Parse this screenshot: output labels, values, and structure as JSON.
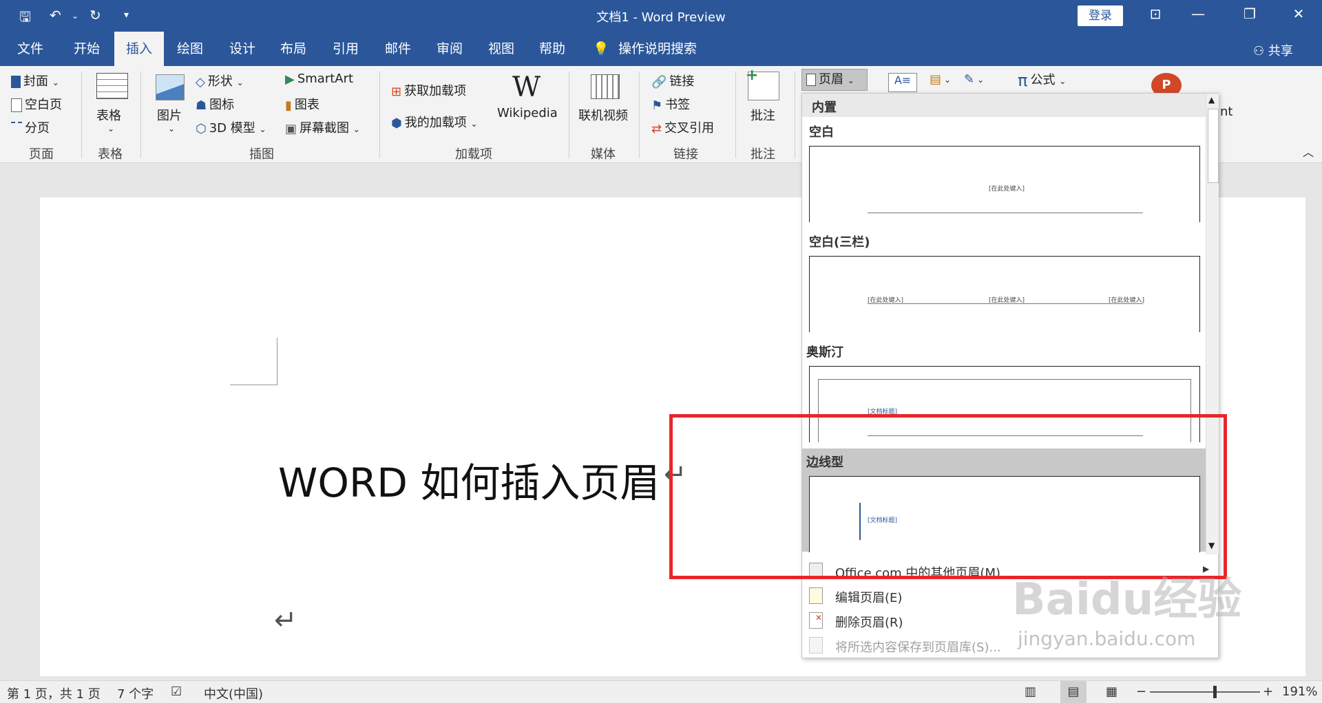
{
  "window": {
    "title": "文档1  -  Word Preview",
    "login_label": "登录"
  },
  "tabs": [
    "文件",
    "开始",
    "插入",
    "绘图",
    "设计",
    "布局",
    "引用",
    "邮件",
    "审阅",
    "视图",
    "帮助"
  ],
  "active_tab": "插入",
  "tell_me": "操作说明搜索",
  "share_label": "共享",
  "ribbon": {
    "pages": {
      "cover": "封面",
      "blank_page": "空白页",
      "page_break": "分页",
      "group": "页面"
    },
    "tables": {
      "table": "表格",
      "group": "表格"
    },
    "illustrations": {
      "pictures": "图片",
      "shapes": "形状",
      "icons": "图标",
      "models3d": "3D 模型",
      "smartart": "SmartArt",
      "chart": "图表",
      "screenshot": "屏幕截图",
      "group": "插图"
    },
    "addins": {
      "get": "获取加载项",
      "my": "我的加载项",
      "wikipedia": "Wikipedia",
      "group": "加载项"
    },
    "media": {
      "online_video": "联机视频",
      "group": "媒体"
    },
    "links": {
      "link": "链接",
      "bookmark": "书签",
      "cross_ref": "交叉引用",
      "group": "链接"
    },
    "comments": {
      "comment": "批注",
      "group": "批注"
    },
    "header_button": "页眉",
    "equation": "公式",
    "partial_text": "nt"
  },
  "document": {
    "title": "WORD 如何插入页眉"
  },
  "dropdown": {
    "section": "内置",
    "items": [
      {
        "name": "空白",
        "placeholder": "[在此处键入]"
      },
      {
        "name": "空白(三栏)",
        "placeholder": "[在此处键入]"
      },
      {
        "name": "奥斯汀",
        "placeholder": "[文档标题]"
      },
      {
        "name": "边线型",
        "placeholder": "[文档标题]"
      }
    ],
    "menu": [
      {
        "label": "Office.com 中的其他页眉(M)",
        "enabled": true
      },
      {
        "label": "编辑页眉(E)",
        "enabled": true
      },
      {
        "label": "删除页眉(R)",
        "enabled": true
      },
      {
        "label": "将所选内容保存到页眉库(S)...",
        "enabled": false
      }
    ]
  },
  "status": {
    "page": "第 1 页，共 1 页",
    "words": "7 个字",
    "language": "中文(中国)",
    "zoom": "191%"
  },
  "watermark": {
    "brand": "Baidu经验",
    "url": "jingyan.baidu.com"
  },
  "colors": {
    "brand": "#2b579a",
    "highlight": "#e8262b"
  }
}
